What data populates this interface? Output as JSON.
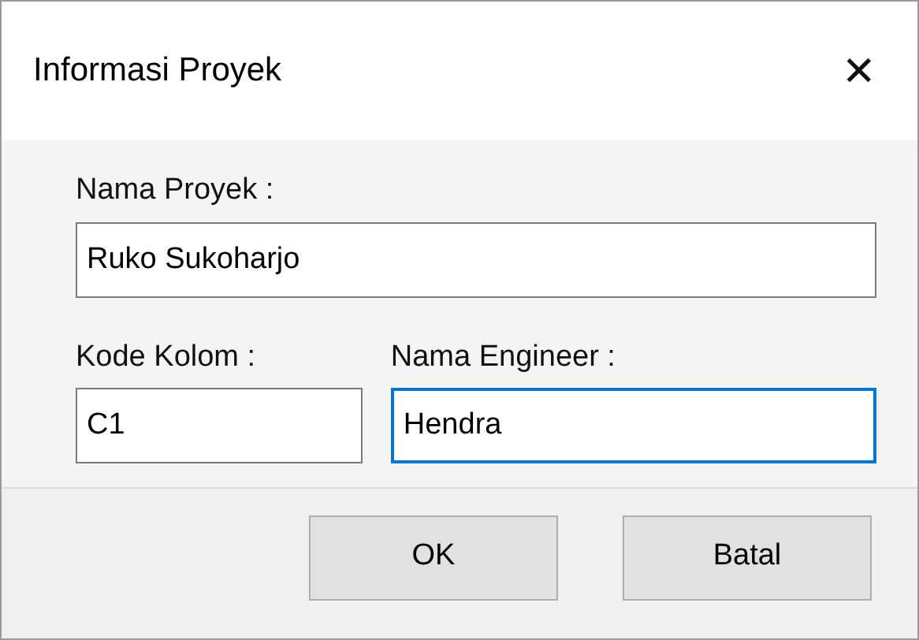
{
  "window": {
    "title": "Informasi Proyek",
    "close": "✕"
  },
  "field_rows": [
    [
      {
        "label": "Nama Proyek :",
        "value": "Ruko Sukoharjo",
        "focused": false
      }
    ],
    [
      {
        "label": "Kode Kolom :",
        "value": "C1",
        "focused": false
      },
      {
        "label": "Nama Engineer :",
        "value": "Hendra",
        "focused": true
      }
    ]
  ],
  "buttons": [
    "OK",
    "Batal"
  ]
}
